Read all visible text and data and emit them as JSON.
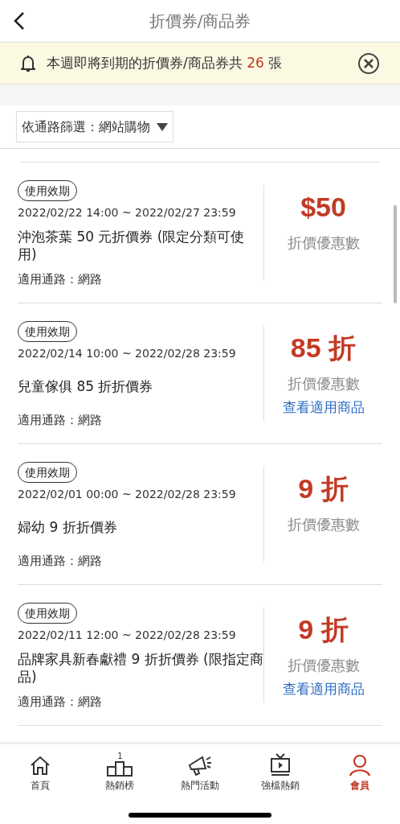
{
  "header": {
    "title": "折價券/商品券"
  },
  "notice": {
    "before": "本週即將到期的折價券/商品券共",
    "count": "26",
    "after": "張"
  },
  "filter": {
    "label": "依通路篩選：網站購物"
  },
  "coupons": [
    {
      "tag": "使用效期",
      "period": "2022/02/22 14:00 ~ 2022/02/27 23:59",
      "title": "沖泡茶葉 50 元折價券 (限定分類可使用)",
      "channel": "適用通路：網路",
      "value": "$50",
      "value_label": "折價優惠數"
    },
    {
      "tag": "使用效期",
      "period": "2022/02/14 10:00 ~ 2022/02/28 23:59",
      "title": "兒童傢俱 85 折折價券",
      "channel": "適用通路：網路",
      "value": "85 折",
      "value_label": "折價優惠數",
      "link": "查看適用商品"
    },
    {
      "tag": "使用效期",
      "period": "2022/02/01 00:00 ~ 2022/02/28 23:59",
      "title": "婦幼 9 折折價券",
      "channel": "適用通路：網路",
      "value": "9 折",
      "value_label": "折價優惠數"
    },
    {
      "tag": "使用效期",
      "period": "2022/02/11 12:00 ~ 2022/02/28 23:59",
      "title": "品牌家具新春獻禮 9 折折價券 (限指定商品)",
      "channel": "適用通路：網路",
      "value": "9 折",
      "value_label": "折價優惠數",
      "link": "查看適用商品"
    }
  ],
  "nav": [
    {
      "kind": "home",
      "label": "首頁",
      "selected": false
    },
    {
      "kind": "podium",
      "label": "熱銷榜",
      "badge": "1",
      "selected": false
    },
    {
      "kind": "megaphone",
      "label": "熱門活動",
      "selected": false
    },
    {
      "kind": "tv",
      "label": "強檔熱銷",
      "selected": false
    },
    {
      "kind": "person",
      "label": "會員",
      "selected": true
    }
  ]
}
